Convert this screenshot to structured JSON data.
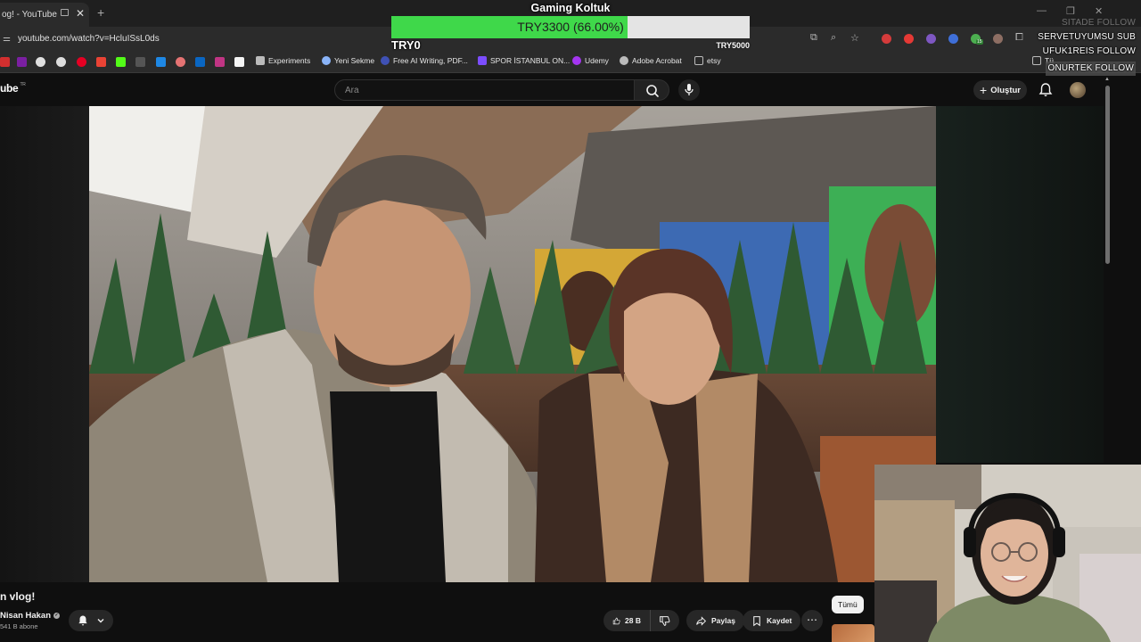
{
  "browser": {
    "tab_title": "og! - YouTube",
    "url": "youtube.com/watch?v=HcluISsL0ds",
    "bookmarks": [
      "Experiments",
      "Yeni Sekme",
      "Free AI Writing, PDF...",
      "SPOR İSTANBUL ON...",
      "Udemy",
      "Adobe Acrobat",
      "etsy"
    ],
    "bookmark_folder_label": "Tü",
    "extension_badge": "15"
  },
  "youtube": {
    "logo_text": "ube",
    "region": "TR",
    "search_placeholder": "Ara",
    "create_label": "Oluştur",
    "video_title": "n vlog!",
    "channel_name": "Nisan Hakan",
    "subscribers": "541 B abone",
    "like_count": "28 B",
    "share_label": "Paylaş",
    "save_label": "Kaydet",
    "chip_label": "Tümü"
  },
  "overlay": {
    "goal_title": "Gaming Koltuk",
    "goal_text": "TRY3300 (66.00%)",
    "goal_progress": 0.66,
    "goal_min": "TRY0",
    "goal_max": "TRY5000",
    "follows": [
      {
        "text": "SITADE  FOLLOW",
        "style": "faint"
      },
      {
        "text": "SERVETUYUMSU  SUB",
        "style": "normal"
      },
      {
        "text": "UFUK1REIS  FOLLOW",
        "style": "normal"
      },
      {
        "text": "ONURTEK  FOLLOW",
        "style": "boxed"
      }
    ]
  },
  "colors": {
    "progress_fill": "#3fd84a",
    "progress_track": "#e4e4e4",
    "page_bg": "#0f0f0f",
    "button_bg": "#272727"
  }
}
